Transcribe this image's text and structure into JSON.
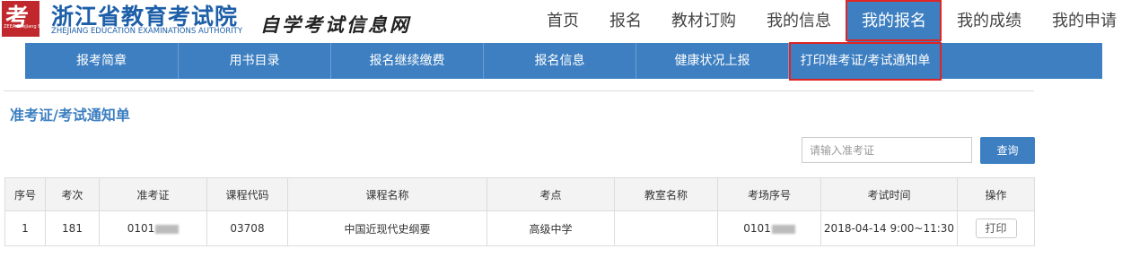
{
  "brand": {
    "logo_glyph": "考",
    "logo_sub": "ZEEA Zhejiang Education Examinations Authority",
    "name": "浙江省教育考试院",
    "name_en": "ZHEJIANG EDUCATION EXAMINATIONS AUTHORITY",
    "site": "自学考试信息网"
  },
  "topnav": [
    "首页",
    "报名",
    "教材订购",
    "我的信息",
    "我的报名",
    "我的成绩",
    "我的申请"
  ],
  "topnav_active": "我的报名",
  "subnav": [
    "报考简章",
    "用书目录",
    "报名继续缴费",
    "报名信息",
    "健康状况上报",
    "打印准考证/考试通知单"
  ],
  "page_title": "准考证/考试通知单",
  "search": {
    "placeholder": "请输入准考证",
    "button": "查询"
  },
  "table": {
    "headers": [
      "序号",
      "考次",
      "准考证",
      "课程代码",
      "课程名称",
      "考点",
      "教室名称",
      "考场序号",
      "考试时间",
      "操作"
    ],
    "rows": [
      {
        "index": "1",
        "session": "181",
        "ticket": "0101",
        "course_code": "03708",
        "course_name": "中国近现代史纲要",
        "site": "高级中学",
        "room": "",
        "seat_no": "0101",
        "time": "2018-04-14 9:00~11:30",
        "action": "打印"
      }
    ]
  },
  "colors": {
    "brand_blue": "#3d7fc1",
    "highlight_red": "#e02525",
    "logo_red": "#c0282d"
  }
}
